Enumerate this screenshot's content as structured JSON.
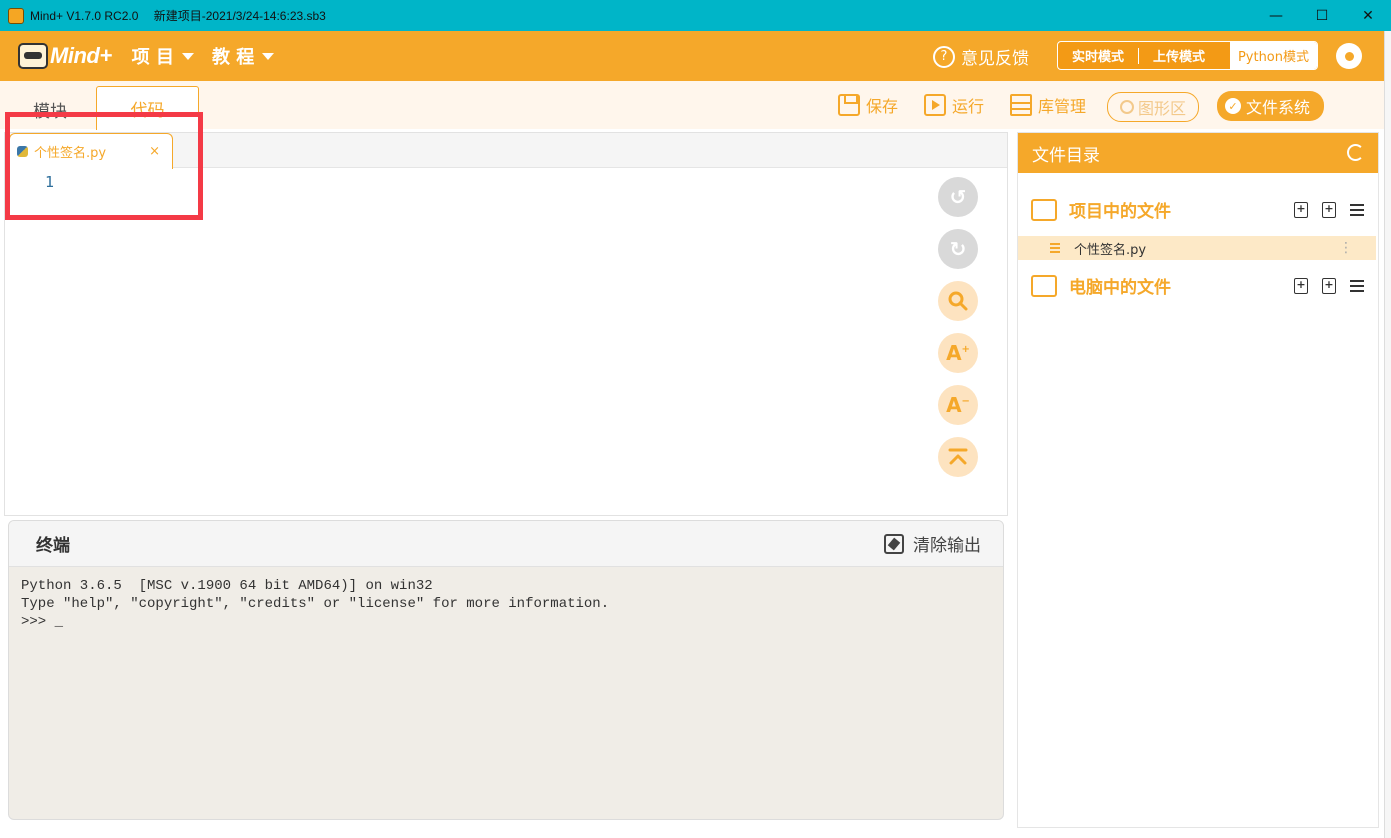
{
  "window": {
    "app_title": "Mind+ V1.7.0 RC2.0",
    "project_title": "新建项目-2021/3/24-14:6:23.sb3",
    "minimize": "—",
    "maximize": "☐",
    "close": "✕"
  },
  "menubar": {
    "logo_text": "Mind+",
    "items": [
      {
        "label": "项 目"
      },
      {
        "label": "教 程"
      }
    ],
    "feedback": "意见反馈",
    "modes": [
      "实时模式",
      "上传模式",
      "Python模式"
    ],
    "active_mode": "Python模式"
  },
  "toolbar": {
    "tabs": [
      "模块",
      "代码"
    ],
    "active_tab": "代码",
    "save": "保存",
    "run": "运行",
    "library": "库管理",
    "graphic": "图形区",
    "filesystem": "文件系统"
  },
  "editor": {
    "file_tab": "个性签名.py",
    "close_symbol": "×",
    "line_numbers": [
      "1"
    ],
    "side_buttons": [
      {
        "name": "undo",
        "icon": "undo-icon"
      },
      {
        "name": "redo",
        "icon": "redo-icon"
      },
      {
        "name": "search",
        "icon": "search-icon"
      },
      {
        "name": "font-increase",
        "label": "A⁺"
      },
      {
        "name": "font-decrease",
        "label": "A⁻"
      },
      {
        "name": "scroll-top",
        "icon": "arrow-up-bar-icon"
      }
    ]
  },
  "terminal": {
    "title": "终端",
    "clear_label": "清除输出",
    "lines": [
      "Python 3.6.5  [MSC v.1900 64 bit AMD64)] on win32",
      "Type \"help\", \"copyright\", \"credits\" or \"license\" for more information.",
      ">>> _"
    ]
  },
  "files": {
    "title": "文件目录",
    "project_section": "项目中的文件",
    "project_files": [
      "个性签名.py"
    ],
    "computer_section": "电脑中的文件",
    "more_symbol": "⋮"
  },
  "colors": {
    "accent": "#f5a82a",
    "titlebar": "#00b5c8",
    "highlight": "#f43a46"
  }
}
